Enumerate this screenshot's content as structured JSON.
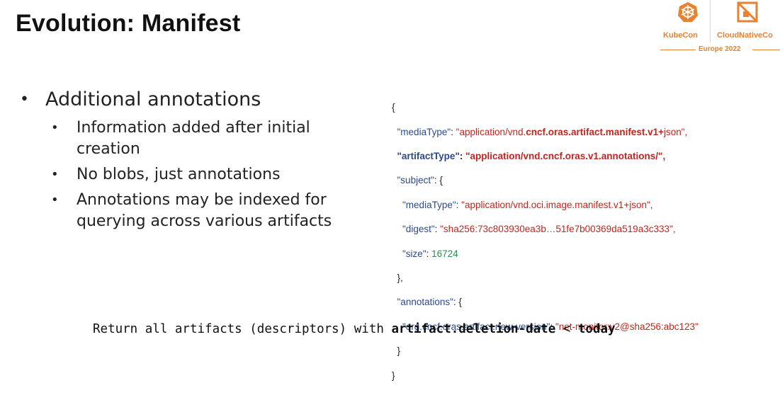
{
  "slide": {
    "title": "Evolution: Manifest"
  },
  "logo": {
    "kubecon": "KubeCon",
    "cloudnative": "CloudNativeCo",
    "event": "Europe 2022"
  },
  "bullets": {
    "main": "Additional annotations",
    "sub": [
      "Information added after initial creation",
      "No blobs, just annotations",
      "Annotations may be indexed for querying across various artifacts"
    ]
  },
  "json": {
    "open": "{",
    "l1_key": "\"mediaType\"",
    "l1_sep": ": ",
    "l1_val_a": "\"application/vnd.",
    "l1_val_b": "cncf.oras.artifact.manifest.v1+",
    "l1_val_c": "json\",",
    "l2_key": "\"artifactType\"",
    "l2_sep": ": ",
    "l2_val": "\"application/vnd.cncf.oras.v1.annotations/\",",
    "l3_key": "\"subject\"",
    "l3_rest": ": {",
    "l4_key": "\"mediaType\"",
    "l4_sep": ": ",
    "l4_val": "\"application/vnd.oci.image.manifest.v1+json\",",
    "l5_key": "\"digest\"",
    "l5_sep": ": ",
    "l5_val": "\"sha256:73c803930ea3b…51fe7b00369da519a3c333\",",
    "l6_key": "\"size\"",
    "l6_sep": ": ",
    "l6_val": "16724",
    "l7": "},",
    "l8_key": "\"annotations\"",
    "l8_rest": ": {",
    "l9_key": "\"org.cncf.oras.artifact.new-version\"",
    "l9_sep": ": ",
    "l9_val": "\"net-monitor:v2@sha256:abc123\"",
    "l10": "}",
    "close": "}"
  },
  "query": {
    "prefix": "Return all artifacts (descriptors) with ",
    "field": "artifact.deletion-date",
    "op": " < ",
    "value": "today"
  },
  "colors": {
    "accent_orange": "#e88230",
    "json_key": "#2c4a8a",
    "json_string": "#c0261f",
    "json_number": "#2e8b57"
  }
}
